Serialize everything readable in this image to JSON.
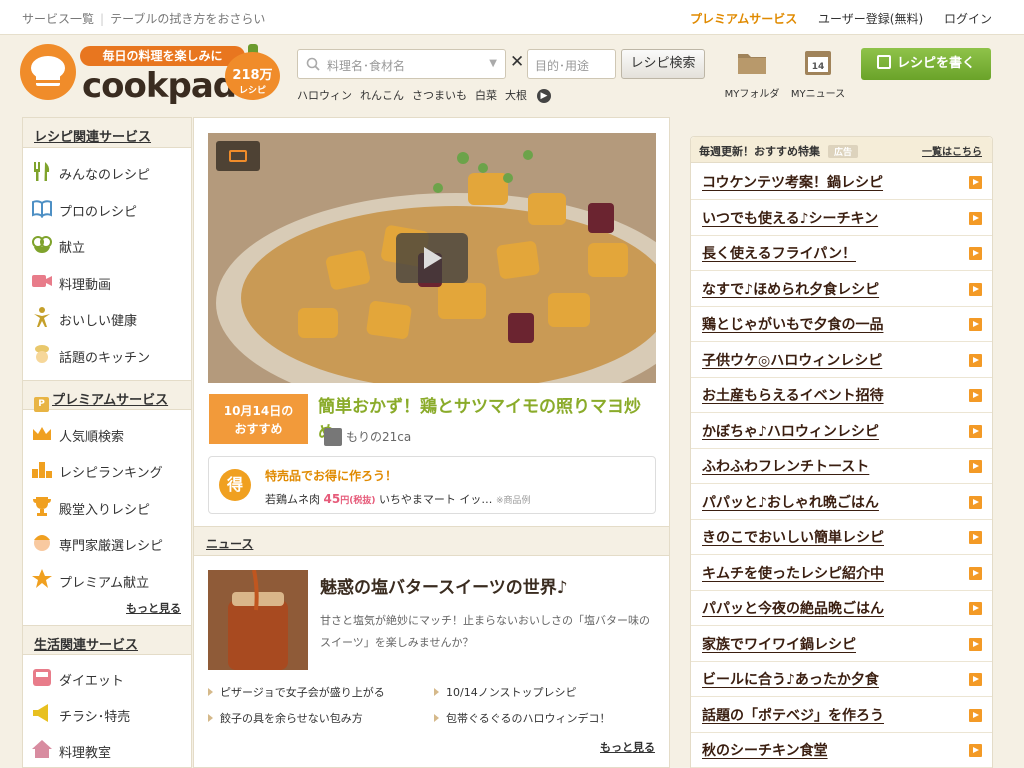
{
  "topbar": {
    "left": [
      "サービス一覧",
      "テーブルの拭き方をおさらい"
    ],
    "premium": "プレミアムサービス",
    "register": "ユーザー登録(無料)",
    "login": "ログイン"
  },
  "logo": {
    "tagline": "毎日の料理を楽しみに",
    "wordmark": "cookpad",
    "count": "218万",
    "count_label": "レシピ"
  },
  "search": {
    "placeholder1": "料理名･食材名",
    "times": "✕",
    "placeholder2": "目的･用途",
    "button": "レシピ検索",
    "keywords": [
      "ハロウィン",
      "れんこん",
      "さつまいも",
      "白菜",
      "大根"
    ]
  },
  "header_icons": [
    {
      "label": "MYフォルダ",
      "icon": "folder-icon"
    },
    {
      "label": "MYニュース",
      "icon": "calendar-icon",
      "day": "14"
    }
  ],
  "write_button": "レシピを書く",
  "sidebar": {
    "section1": "レシピ関連サービス",
    "items1": [
      {
        "label": "みんなのレシピ",
        "icon": "fork-knife-icon"
      },
      {
        "label": "プロのレシピ",
        "icon": "book-icon"
      },
      {
        "label": "献立",
        "icon": "bowl-icon"
      },
      {
        "label": "料理動画",
        "icon": "video-icon"
      },
      {
        "label": "おいしい健康",
        "icon": "person-icon"
      },
      {
        "label": "話題のキッチン",
        "icon": "chef-icon"
      }
    ],
    "section2": "プレミアムサービス",
    "items2": [
      {
        "label": "人気順検索",
        "icon": "crown-icon"
      },
      {
        "label": "レシピランキング",
        "icon": "ranking-icon"
      },
      {
        "label": "殿堂入りレシピ",
        "icon": "trophy-icon"
      },
      {
        "label": "専門家厳選レシピ",
        "icon": "expert-icon"
      },
      {
        "label": "プレミアム献立",
        "icon": "star-icon"
      }
    ],
    "more": "もっと見る",
    "section3": "生活関連サービス",
    "items3": [
      {
        "label": "ダイエット",
        "icon": "scale-icon"
      },
      {
        "label": "チラシ･特売",
        "icon": "megaphone-icon"
      },
      {
        "label": "料理教室",
        "icon": "house-icon"
      }
    ]
  },
  "featured": {
    "badge_date": "10月14日の",
    "badge_label": "おすすめ",
    "title": "簡単おかず！鶏とサツマイモの照りマヨ炒め",
    "author": "もりの21ca"
  },
  "promo": {
    "icon_char": "得",
    "headline": "特売品でお得に作ろう！",
    "item": "若鶏ムネ肉",
    "price": "45",
    "price_suffix": "円(税抜)",
    "store": "いちやまマート イッ…",
    "note": "※商品例"
  },
  "news": {
    "header": "ニュース",
    "title": "魅惑の塩バタースイーツの世界♪",
    "desc": "甘さと塩気が絶妙にマッチ！止まらないおいしさの「塩バター味のスイーツ」を楽しみませんか？",
    "links": [
      "ピザージョで女子会が盛り上がる",
      "10/14ノンストップレシピ",
      "餃子の具を余らせない包み方",
      "包帯ぐるぐるのハロウィンデコ！"
    ],
    "more": "もっと見る"
  },
  "right_panel": {
    "title": "毎週更新！おすすめ特集",
    "ad": "広告",
    "all": "一覧はこちら",
    "items": [
      "コウケンテツ考案！鍋レシピ",
      "いつでも使える♪シーチキン",
      "長く使えるフライパン！",
      "なすで♪ほめられ夕食レシピ",
      "鶏とじゃがいもで夕食の一品",
      "子供ウケ◎ハロウィンレシピ",
      "お土産もらえるイベント招待",
      "かぼちゃ♪ハロウィンレシピ",
      "ふわふわフレンチトースト",
      "パパッと♪おしゃれ晩ごはん",
      "きのこでおいしい簡単レシピ",
      "キムチを使ったレシピ紹介中",
      "パパッと今夜の絶品晩ごはん",
      "家族でワイワイ鍋レシピ",
      "ビールに合う♪あったか夕食",
      "話題の「ポテベジ」を作ろう",
      "秋のシーチキン食堂"
    ]
  },
  "colors": {
    "accent": "#f08c2a",
    "green": "#6aa329",
    "title_green": "#8aab2a",
    "bg": "#f5f0e4"
  }
}
